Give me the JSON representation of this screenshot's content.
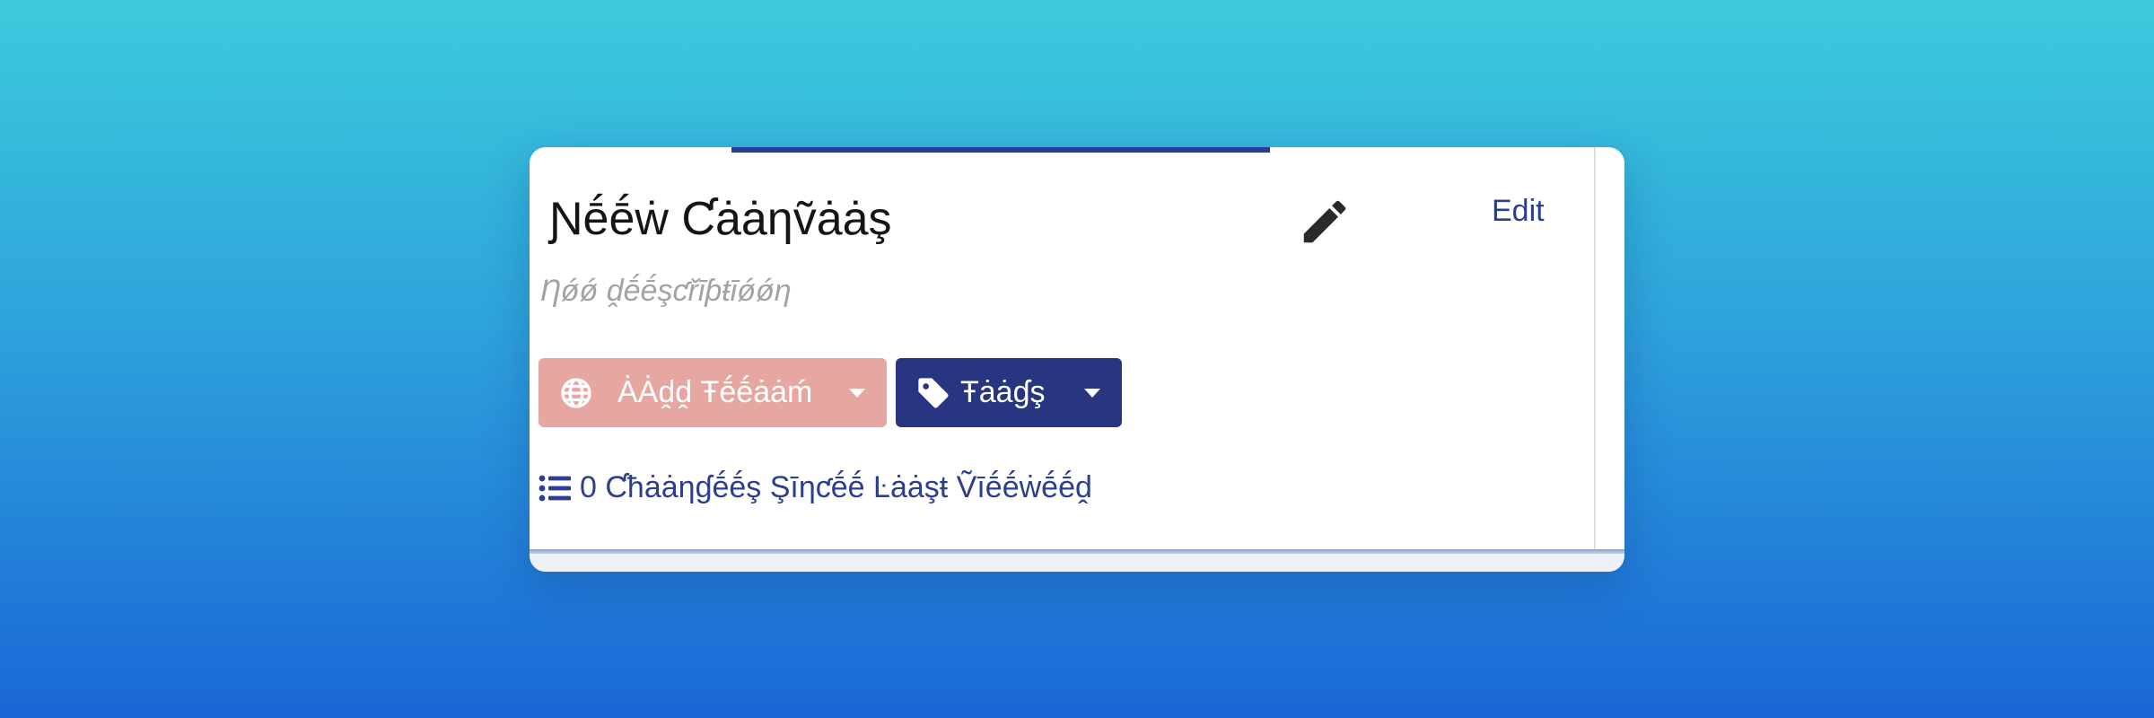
{
  "canvas": {
    "title": "Ɲḗḗẇ Ƈȧȧƞṽȧȧş",
    "description_placeholder": "Ƞǿǿ ḓḗḗşƈřīƥŧīǿǿƞ",
    "edit_label": "Edit"
  },
  "actions": {
    "add_team": {
      "label": "ȦȦḓḓ Ŧḗḗȧȧḿ",
      "icon": "globe-icon",
      "color": "#e5a7a0"
    },
    "tags": {
      "label": "Ŧȧȧɠş",
      "icon": "tag-icon",
      "color": "#283580"
    }
  },
  "changes": {
    "icon": "list-icon",
    "count": "0",
    "label": "Ƈħȧȧƞɠḗḗş Şīƞƈḗḗ Ŀȧȧşŧ Ṽīḗḗẇḗḗḓ"
  },
  "colors": {
    "accent": "#283e96",
    "link": "#2c3e8f"
  }
}
